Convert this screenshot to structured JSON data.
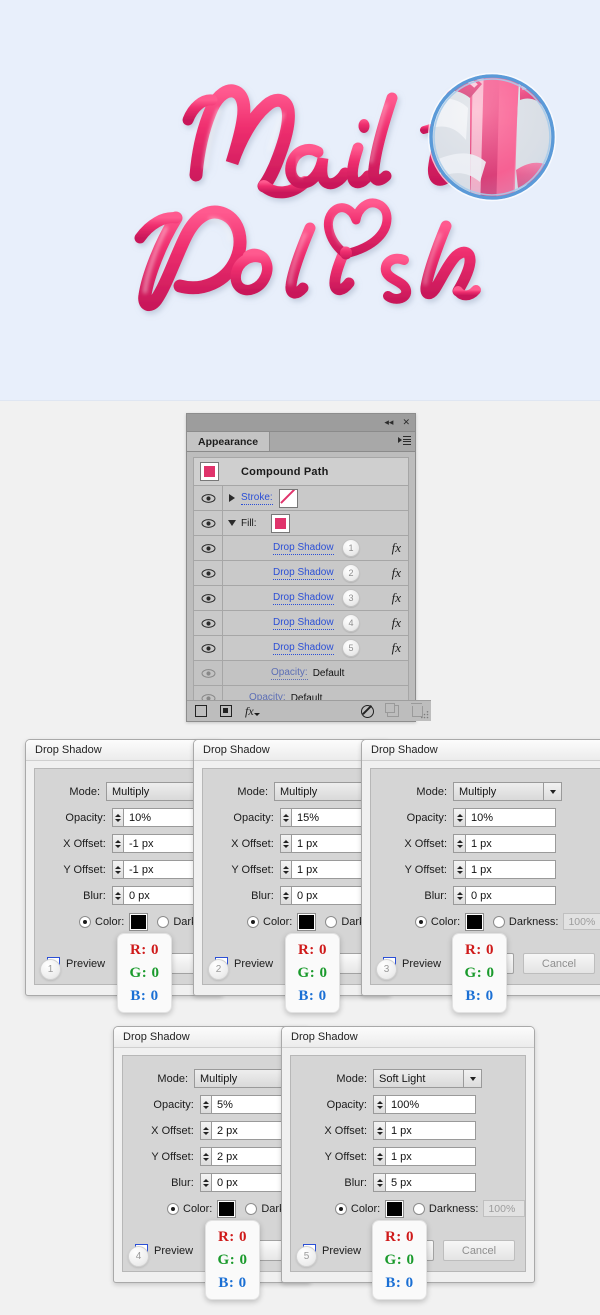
{
  "artwork": {
    "name": "nail-polish-lettering",
    "word_top": "Nail",
    "word_bottom": "Polish",
    "background_color": "#e8effb",
    "letter_color": "#e0336b",
    "letter_highlight": "#ff86b0",
    "magnifier_ring_color": "#5b9ad8"
  },
  "panel": {
    "title": "Appearance",
    "tab_label": "Appearance",
    "collapse_icon": "double-chevron-left-icon",
    "close_icon": "close-icon",
    "menu_icon": "panel-menu-icon",
    "object_title": "Compound Path",
    "stroke_label": "Stroke:",
    "fill_label": "Fill:",
    "effects": [
      {
        "label": "Drop Shadow",
        "badge": "1",
        "fx": "fx"
      },
      {
        "label": "Drop Shadow",
        "badge": "2",
        "fx": "fx"
      },
      {
        "label": "Drop Shadow",
        "badge": "3",
        "fx": "fx"
      },
      {
        "label": "Drop Shadow",
        "badge": "4",
        "fx": "fx"
      },
      {
        "label": "Drop Shadow",
        "badge": "5",
        "fx": "fx"
      }
    ],
    "opacity_rows": [
      {
        "label": "Opacity:",
        "value": "Default"
      },
      {
        "label": "Opacity:",
        "value": "Default"
      }
    ],
    "footer": {
      "new_stroke_icon": "new-stroke-icon",
      "new_fill_icon": "new-fill-icon",
      "add_effect_icon": "add-effect-fx-icon",
      "clear_appearance_icon": "clear-appearance-icon",
      "duplicate_icon": "duplicate-item-icon",
      "delete_icon": "delete-item-icon"
    }
  },
  "dialogs": [
    {
      "badge": "1",
      "title": "Drop Shadow",
      "mode_label": "Mode:",
      "mode_value": "Multiply",
      "opacity_label": "Opacity:",
      "opacity_value": "10%",
      "xoffset_label": "X Offset:",
      "xoffset_value": "-1 px",
      "yoffset_label": "Y Offset:",
      "yoffset_value": "-1 px",
      "blur_label": "Blur:",
      "blur_value": "0 px",
      "color_label": "Color:",
      "darkness_label": "Dark",
      "darkness_value": "",
      "preview_label": "Preview",
      "cancel_label": "",
      "rgb": {
        "r": "R: 0",
        "g": "G: 0",
        "b": "B: 0"
      }
    },
    {
      "badge": "2",
      "title": "Drop Shadow",
      "mode_label": "Mode:",
      "mode_value": "Multiply",
      "opacity_label": "Opacity:",
      "opacity_value": "15%",
      "xoffset_label": "X Offset:",
      "xoffset_value": "1 px",
      "yoffset_label": "Y Offset:",
      "yoffset_value": "1 px",
      "blur_label": "Blur:",
      "blur_value": "0 px",
      "color_label": "Color:",
      "darkness_label": "Dark",
      "darkness_value": "",
      "preview_label": "Preview",
      "cancel_label": "",
      "rgb": {
        "r": "R: 0",
        "g": "G: 0",
        "b": "B: 0"
      }
    },
    {
      "badge": "3",
      "title": "Drop Shadow",
      "mode_label": "Mode:",
      "mode_value": "Multiply",
      "opacity_label": "Opacity:",
      "opacity_value": "10%",
      "xoffset_label": "X Offset:",
      "xoffset_value": "1 px",
      "yoffset_label": "Y Offset:",
      "yoffset_value": "1 px",
      "blur_label": "Blur:",
      "blur_value": "0 px",
      "color_label": "Color:",
      "darkness_label": "Darkness:",
      "darkness_value": "100%",
      "preview_label": "Preview",
      "cancel_label": "Cancel",
      "rgb": {
        "r": "R: 0",
        "g": "G: 0",
        "b": "B: 0"
      }
    },
    {
      "badge": "4",
      "title": "Drop Shadow",
      "mode_label": "Mode:",
      "mode_value": "Multiply",
      "opacity_label": "Opacity:",
      "opacity_value": "5%",
      "xoffset_label": "X Offset:",
      "xoffset_value": "2 px",
      "yoffset_label": "Y Offset:",
      "yoffset_value": "2 px",
      "blur_label": "Blur:",
      "blur_value": "0 px",
      "color_label": "Color:",
      "darkness_label": "Dark",
      "darkness_value": "",
      "preview_label": "Preview",
      "cancel_label": "",
      "rgb": {
        "r": "R: 0",
        "g": "G: 0",
        "b": "B: 0"
      }
    },
    {
      "badge": "5",
      "title": "Drop Shadow",
      "mode_label": "Mode:",
      "mode_value": "Soft Light",
      "opacity_label": "Opacity:",
      "opacity_value": "100%",
      "xoffset_label": "X Offset:",
      "xoffset_value": "1 px",
      "yoffset_label": "Y Offset:",
      "yoffset_value": "1 px",
      "blur_label": "Blur:",
      "blur_value": "5 px",
      "color_label": "Color:",
      "darkness_label": "Darkness:",
      "darkness_value": "100%",
      "preview_label": "Preview",
      "cancel_label": "Cancel",
      "rgb": {
        "r": "R: 0",
        "g": "G: 0",
        "b": "B: 0"
      }
    }
  ]
}
